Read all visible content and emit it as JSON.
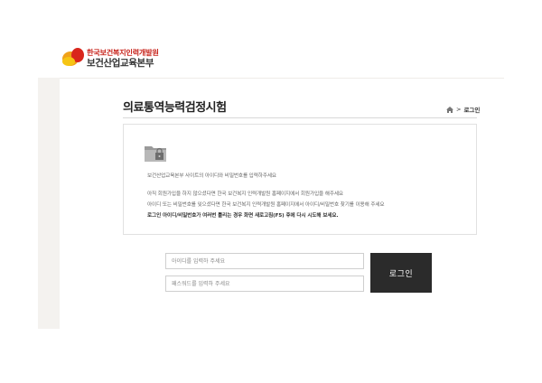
{
  "header": {
    "logo_line1": "한국보건복지인력개발원",
    "logo_line2": "보건산업교육본부",
    "logo_icon": "logo-mark-icon",
    "colors": {
      "red": "#d9261c",
      "orange": "#f0a21a",
      "yellow": "#f6c514"
    }
  },
  "page": {
    "title": "의료통역능력검정시험",
    "breadcrumb": {
      "home_icon": "home-icon",
      "separator": ">",
      "current": "로그인"
    }
  },
  "notice": {
    "icon": "folder-lock-icon",
    "lines": [
      "보건산업교육본부 사이트의 아이디와 비밀번호를 입력하주세요",
      "아직 회원가입을 하지 않으셨다면 한국 보건복지 인력개발원 홈페이지에서 회원가입을 해주세요",
      "아이디 또는 비밀번호를 잊으셨다면 한국 보건복지 인력개발원 홈페이지에서 아이디/비밀번호 찾기를 이용해 주세요",
      "로그인 아이디/비밀번호가 여러번 틀리는 경우 화면 새로고침(F5) 후에 다시 시도해 보세요."
    ]
  },
  "login": {
    "id_placeholder": "아이디를 입력하 주세요",
    "id_value": "",
    "pw_placeholder": "패스워드를 입력하 주세요",
    "pw_value": "",
    "button_label": "로그인",
    "button_color": "#2b2b2b"
  }
}
